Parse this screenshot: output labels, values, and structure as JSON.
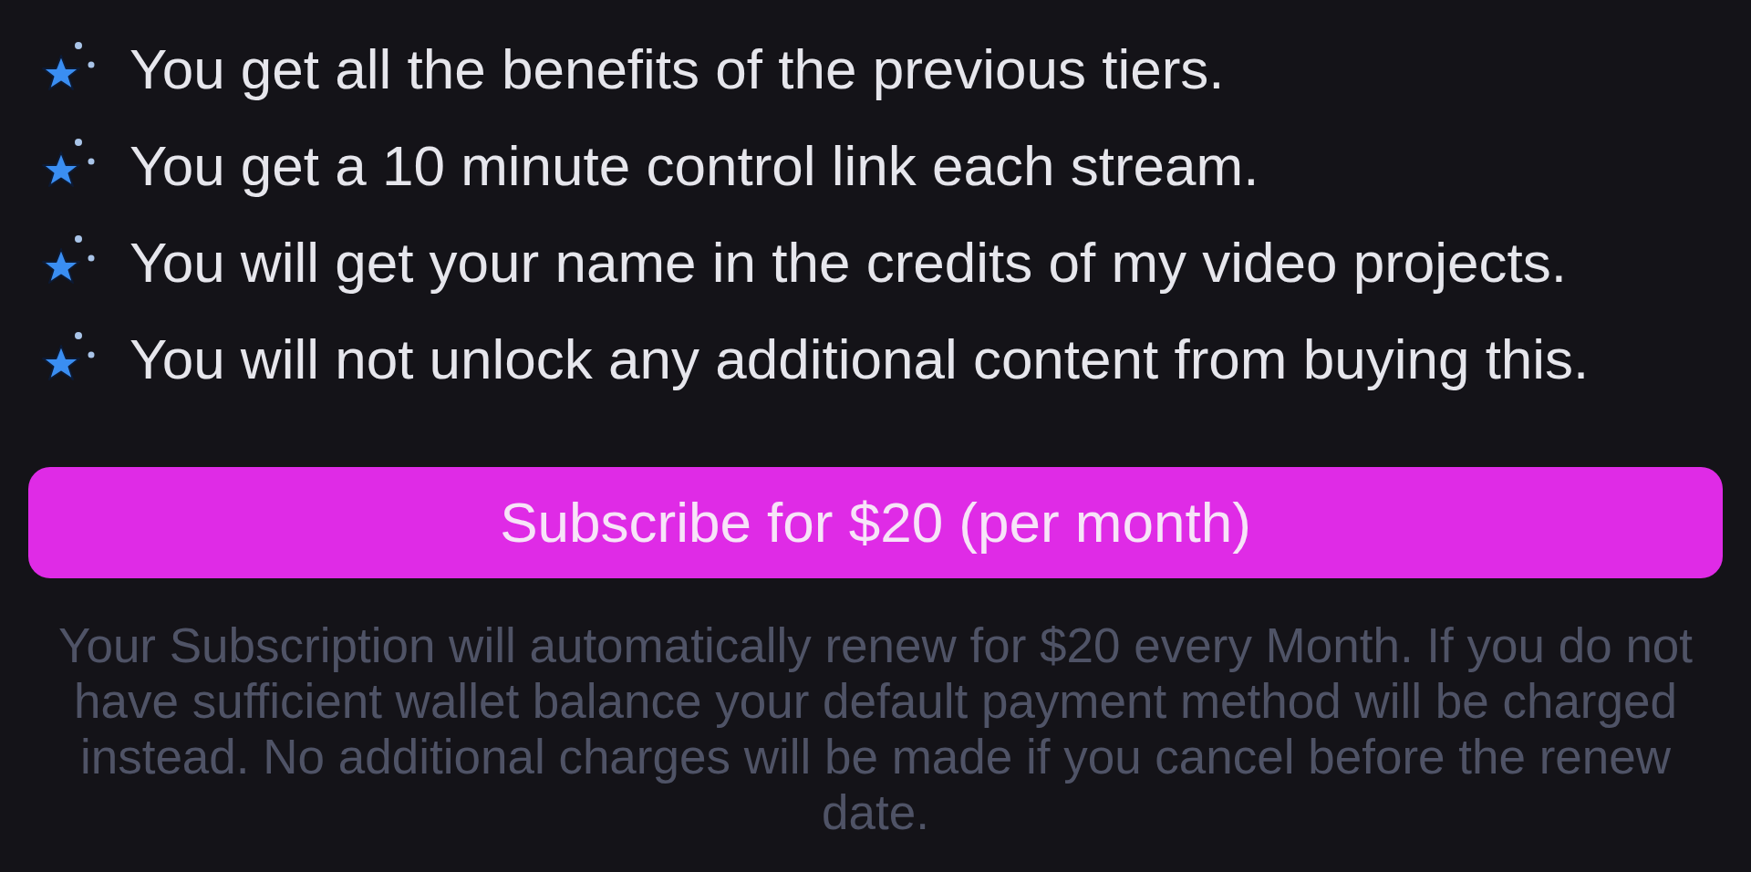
{
  "benefits": [
    "You get all the benefits of the previous tiers.",
    "You get a 10 minute control link each stream.",
    "You will get your name in the credits of my video projects.",
    "You will not unlock any additional content from buying this."
  ],
  "subscribe_button": {
    "label": "Subscribe for $20 (per month)"
  },
  "disclaimer": "Your Subscription will automatically renew for $20 every Month. If you do not have sufficient wallet balance your default payment method will be charged instead. No additional charges will be made if you cancel before the renew date."
}
